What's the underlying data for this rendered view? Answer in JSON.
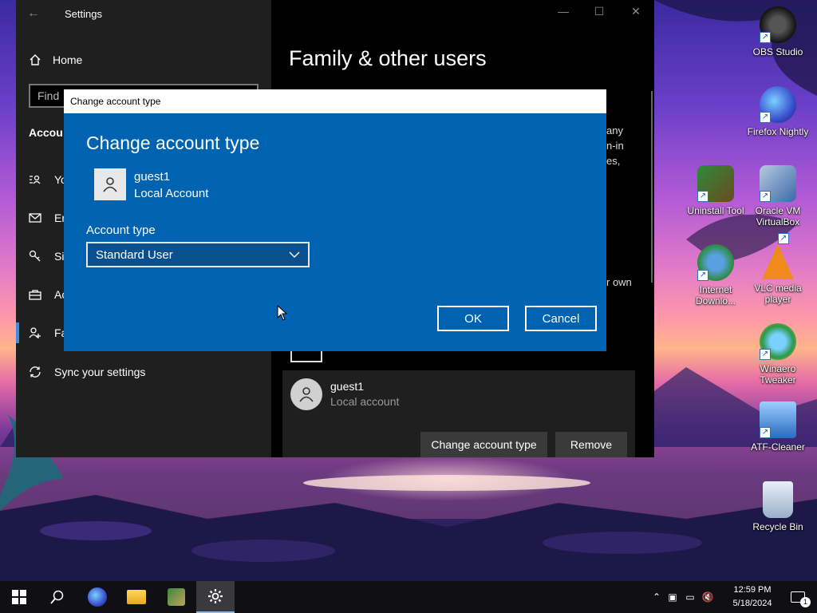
{
  "settings": {
    "title": "Settings",
    "nav": {
      "home_label": "Home",
      "search_placeholder": "Find",
      "section_label": "Accou",
      "items": [
        {
          "label": "Yo"
        },
        {
          "label": "En"
        },
        {
          "label": "Si"
        },
        {
          "label": "Ac"
        },
        {
          "label": "Fa"
        },
        {
          "label": "Sync your settings"
        }
      ]
    },
    "content": {
      "title": "Family & other users",
      "text_fragments": [
        "any",
        "n-in",
        "es,",
        "r own"
      ],
      "user": {
        "name": "guest1",
        "subtitle": "Local account"
      },
      "change_button": "Change account type",
      "remove_button": "Remove"
    }
  },
  "dialog": {
    "window_title": "Change account type",
    "heading": "Change account type",
    "user_name": "guest1",
    "user_subtitle": "Local Account",
    "account_type_label": "Account type",
    "selected_type": "Standard User",
    "ok_label": "OK",
    "cancel_label": "Cancel"
  },
  "desktop_icons": [
    {
      "label": "OBS Studio"
    },
    {
      "label": "Firefox Nightly"
    },
    {
      "label": "Uninstall Tool"
    },
    {
      "label": "Oracle VM VirtualBox"
    },
    {
      "label": "Internet Downlo..."
    },
    {
      "label": "VLC media player"
    },
    {
      "label": "Winaero Tweaker"
    },
    {
      "label": "ATF-Cleaner"
    },
    {
      "label": "Recycle Bin"
    }
  ],
  "taskbar": {
    "time": "12:59 PM",
    "date": "5/18/2024",
    "notification_count": "1"
  },
  "colors": {
    "dialog_blue": "#0063b1",
    "accent": "#3b8edc"
  }
}
